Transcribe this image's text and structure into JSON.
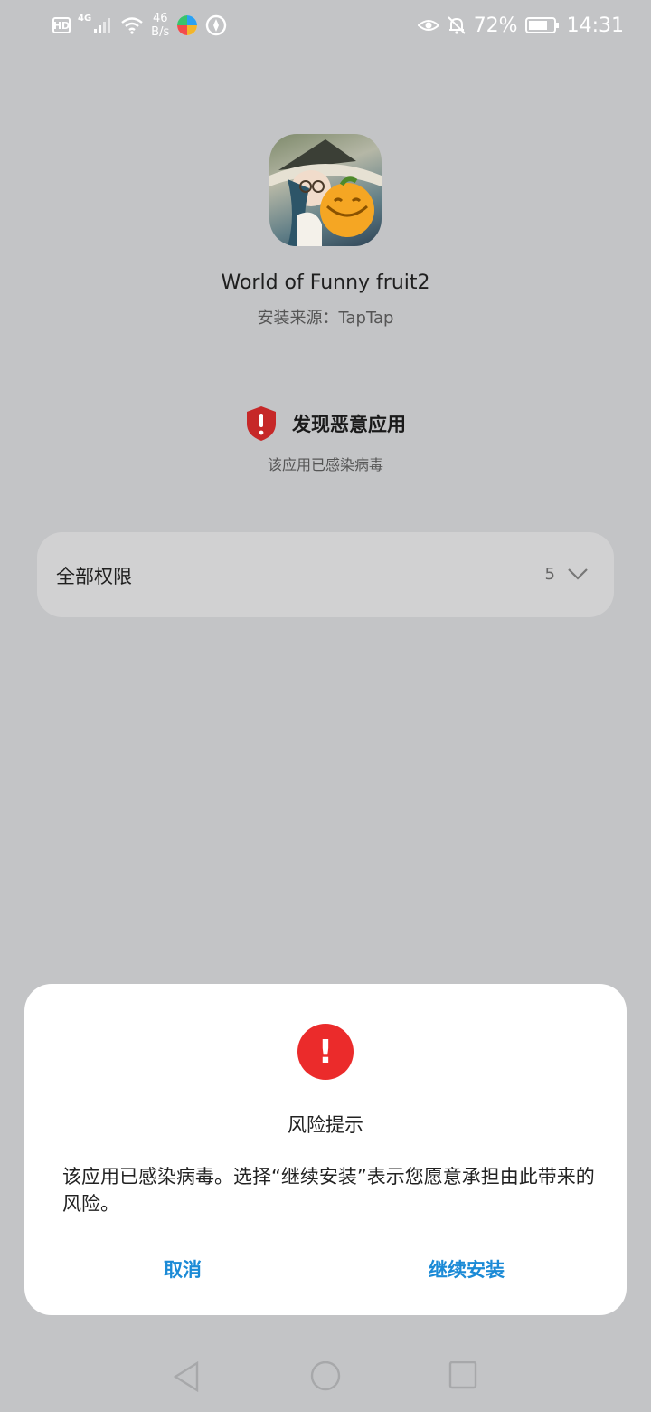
{
  "status_bar": {
    "hd": "HD",
    "network": "4G",
    "speed_value": "46",
    "speed_unit": "B/s",
    "battery": "72%",
    "time": "14:31",
    "icons": [
      "hd-icon",
      "signal-icon",
      "wifi-icon",
      "net-speed",
      "colorful-app-icon",
      "compass-app-icon",
      "eye-icon",
      "bell-off-icon",
      "battery-icon"
    ]
  },
  "app": {
    "name": "World of Funny fruit2",
    "source": "安装来源：TapTap"
  },
  "warning": {
    "title": "发现恶意应用",
    "subtitle": "该应用已感染病毒",
    "color": "#c62828"
  },
  "permissions": {
    "label": "全部权限",
    "count": "5"
  },
  "dialog": {
    "title": "风险提示",
    "message": "该应用已感染病毒。选择“继续安装”表示您愿意承担由此带来的风险。",
    "cancel_label": "取消",
    "continue_label": "继续安装",
    "accent": "#1b8ad6",
    "alert_color": "#eb2b2b"
  }
}
